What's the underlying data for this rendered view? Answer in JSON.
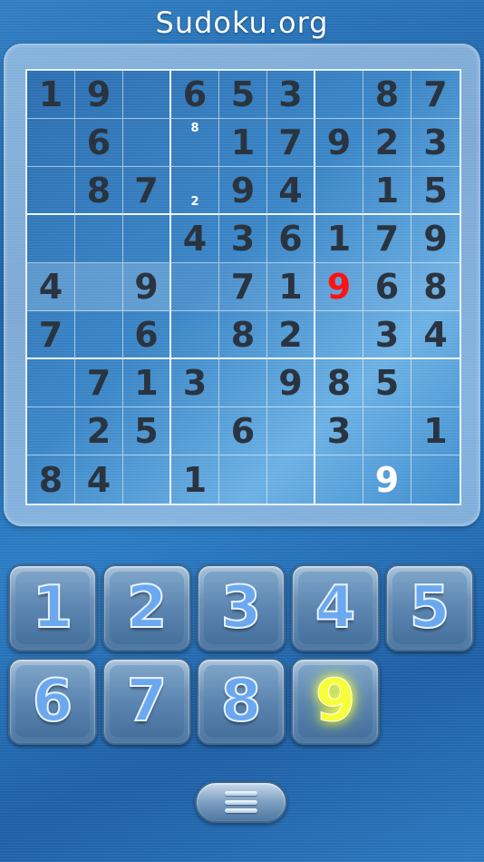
{
  "app": {
    "title": "Sudoku.org"
  },
  "board": {
    "rows": [
      [
        "1",
        "9",
        "",
        "6",
        "5",
        "3",
        "",
        "8",
        "7"
      ],
      [
        "",
        "6",
        "",
        "",
        "1",
        "7",
        "9",
        "2",
        "3"
      ],
      [
        "",
        "8",
        "7",
        "",
        "9",
        "4",
        "",
        "1",
        "5"
      ],
      [
        "",
        "",
        "",
        "4",
        "3",
        "6",
        "1",
        "7",
        "9"
      ],
      [
        "4",
        "",
        "9",
        "",
        "7",
        "1",
        "9",
        "6",
        "8"
      ],
      [
        "7",
        "",
        "6",
        "",
        "8",
        "2",
        "",
        "3",
        "4"
      ],
      [
        "",
        "7",
        "1",
        "3",
        "",
        "9",
        "8",
        "5",
        ""
      ],
      [
        "",
        "2",
        "5",
        "",
        "6",
        "",
        "3",
        "",
        "1"
      ],
      [
        "8",
        "4",
        "",
        "1",
        "",
        "",
        "",
        "9",
        ""
      ]
    ],
    "notes": [
      {
        "row": 1,
        "col": 3,
        "pos": "top",
        "value": "8"
      },
      {
        "row": 2,
        "col": 3,
        "pos": "bottom",
        "value": "2"
      }
    ],
    "highlight_row": 4,
    "error_cells": [
      [
        4,
        6
      ]
    ],
    "user_cells": [
      [
        8,
        7
      ]
    ],
    "colors": {
      "given": "#2a3440",
      "error": "#ff1212",
      "user": "#ffffff"
    }
  },
  "keypad": {
    "keys": [
      "1",
      "2",
      "3",
      "4",
      "5",
      "6",
      "7",
      "8",
      "9"
    ],
    "selected": "9"
  },
  "menu": {
    "icon": "hamburger-menu-icon"
  }
}
